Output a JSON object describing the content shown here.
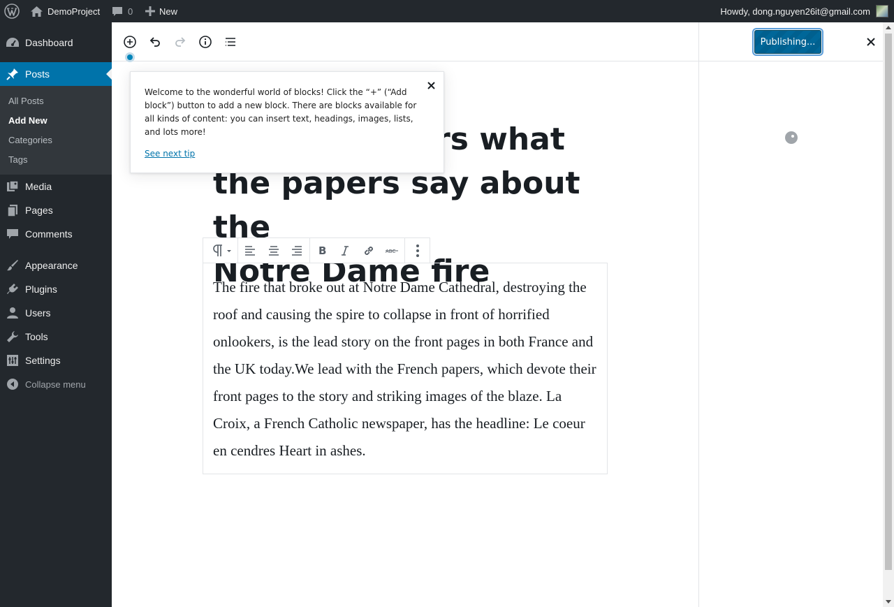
{
  "adminbar": {
    "site_name": "DemoProject",
    "comments_count": "0",
    "new_label": "New",
    "howdy": "Howdy, dong.nguyen26it@gmail.com"
  },
  "sidebar": {
    "items": [
      {
        "label": "Dashboard",
        "icon": "dashboard-icon"
      },
      {
        "label": "Posts",
        "icon": "pin-icon"
      },
      {
        "label": "Media",
        "icon": "media-icon"
      },
      {
        "label": "Pages",
        "icon": "pages-icon"
      },
      {
        "label": "Comments",
        "icon": "comments-icon"
      },
      {
        "label": "Appearance",
        "icon": "brush-icon"
      },
      {
        "label": "Plugins",
        "icon": "plugin-icon"
      },
      {
        "label": "Users",
        "icon": "users-icon"
      },
      {
        "label": "Tools",
        "icon": "wrench-icon"
      },
      {
        "label": "Settings",
        "icon": "settings-icon"
      }
    ],
    "posts_submenu": [
      "All Posts",
      "Add New",
      "Categories",
      "Tags"
    ],
    "collapse_label": "Collapse menu"
  },
  "editor": {
    "publish_label": "Publishing...",
    "title_lines": [
      "Here's what",
      "the papers say about the",
      "Notre Dame fire"
    ],
    "title_visible_fragment": "rs what",
    "paragraph": "The fire that broke out at Notre Dame Cathedral, destroying the roof and causing the spire to collapse in front of horrified onlookers, is the lead story on the front pages in both France and the UK today.We lead with the French papers, which devote their front pages to the story and striking images of the blaze. La Croix, a French Catholic newspaper, has the headline: Le coeur en cendres Heart in ashes."
  },
  "tip": {
    "text": "Welcome to the wonderful world of blocks! Click the “+” (“Add block”) button to add a new block. There are blocks available for all kinds of content: you can insert text, headings, images, lists, and lots more!",
    "link": "See next tip"
  },
  "colors": {
    "admin_dark": "#23282d",
    "accent": "#0073aa",
    "publish_blue": "#006799"
  }
}
